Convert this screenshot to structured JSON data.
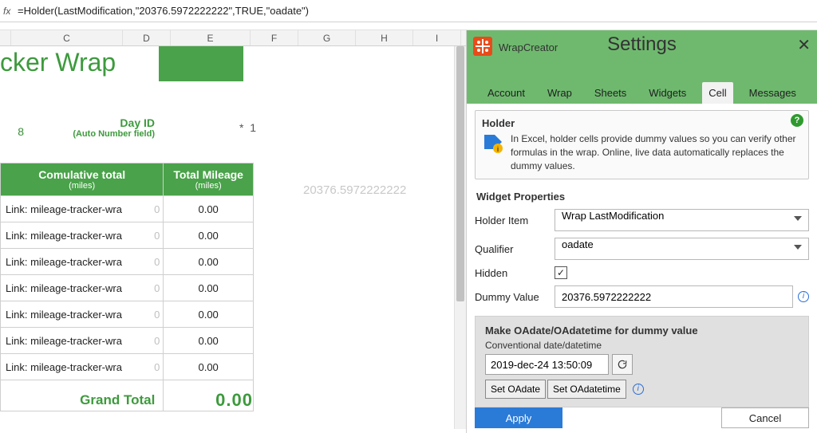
{
  "formula": "=Holder(LastModification,\"20376.5972222222\",TRUE,\"oadate\")",
  "fx": "fx",
  "columns": [
    "C",
    "D",
    "E",
    "F",
    "G",
    "H",
    "I"
  ],
  "sheet": {
    "title_partial": "cker Wrap",
    "day_id_value": "8",
    "day_id_label": "Day ID",
    "day_id_sub": "(Auto Number field)",
    "star_marker": "*",
    "star_value": "1",
    "float_number": "20376.5972222222",
    "table": {
      "head1": {
        "main": "Comulative total",
        "sub": "(miles)"
      },
      "head2": {
        "main": "Total Mileage",
        "sub": "(miles)"
      },
      "rows": [
        {
          "link": "Link: mileage-tracker-wra",
          "mileage": "0.00"
        },
        {
          "link": "Link: mileage-tracker-wra",
          "mileage": "0.00"
        },
        {
          "link": "Link: mileage-tracker-wra",
          "mileage": "0.00"
        },
        {
          "link": "Link: mileage-tracker-wra",
          "mileage": "0.00"
        },
        {
          "link": "Link: mileage-tracker-wra",
          "mileage": "0.00"
        },
        {
          "link": "Link: mileage-tracker-wra",
          "mileage": "0.00"
        },
        {
          "link": "Link: mileage-tracker-wra",
          "mileage": "0.00"
        }
      ],
      "grand_label": "Grand Total",
      "grand_value": "0.00"
    }
  },
  "panel": {
    "app_name": "WrapCreator",
    "title": "Settings",
    "tabs": [
      "Account",
      "Wrap",
      "Sheets",
      "Widgets",
      "Cell",
      "Messages"
    ],
    "active_tab": "Cell",
    "holder": {
      "title": "Holder",
      "desc": "In Excel, holder cells provide dummy values so you can verify other formulas in the wrap. Online, live data automatically replaces the dummy values."
    },
    "section": "Widget Properties",
    "props": {
      "holder_item_label": "Holder Item",
      "holder_item_value": "Wrap LastModification",
      "qualifier_label": "Qualifier",
      "qualifier_value": "oadate",
      "hidden_label": "Hidden",
      "hidden_checked": true,
      "dummy_label": "Dummy Value",
      "dummy_value": "20376.5972222222"
    },
    "oa": {
      "title": "Make OAdate/OAdatetime for dummy value",
      "sub": "Conventional date/datetime",
      "date_value": "2019-dec-24 13:50:09",
      "btn1": "Set OAdate",
      "btn2": "Set OAdatetime"
    },
    "apply": "Apply",
    "cancel": "Cancel"
  }
}
